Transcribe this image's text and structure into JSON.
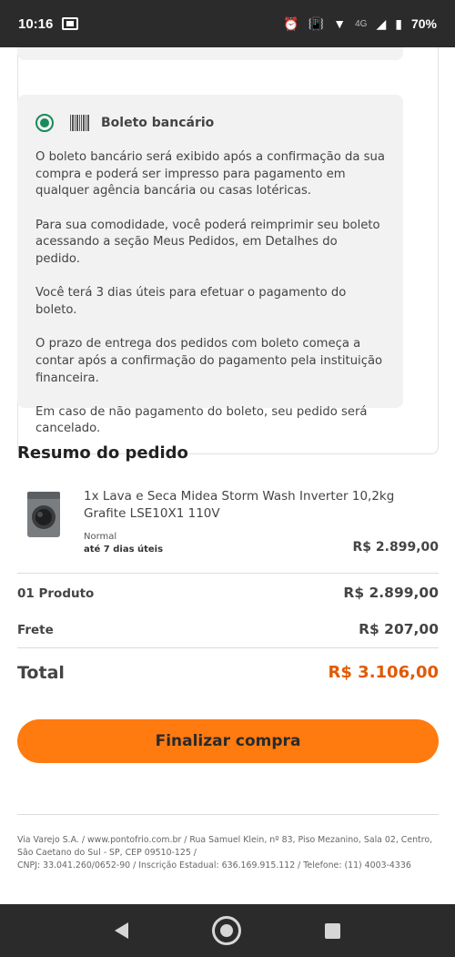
{
  "status_bar": {
    "time": "10:16",
    "network": "4G",
    "battery": "70%",
    "icons": [
      "outlook-icon",
      "alarm-icon",
      "vibrate-icon",
      "wifi-icon",
      "signal-icon",
      "battery-icon"
    ]
  },
  "payment": {
    "method_label": "Boleto bancário",
    "selected": true,
    "paragraphs": [
      "O boleto bancário será exibido após a confirmação da sua compra e poderá ser impresso para pagamento em qualquer agência bancária ou casas lotéricas.",
      "Para sua comodidade, você poderá reimprimir seu boleto acessando a seção Meus Pedidos, em Detalhes do pedido.",
      "Você terá 3 dias úteis para efetuar o pagamento do boleto.",
      "O prazo de entrega dos pedidos com boleto começa a contar após a confirmação do pagamento pela instituição financeira.",
      "Em caso de não pagamento do boleto, seu pedido será cancelado."
    ]
  },
  "summary": {
    "title": "Resumo do pedido",
    "item": {
      "name": "1x Lava e Seca Midea Storm Wash Inverter 10,2kg Grafite LSE10X1 110V",
      "shipping_type": "Normal",
      "shipping_time": "até 7 dias úteis",
      "price": "R$ 2.899,00"
    },
    "products_label": "01 Produto",
    "products_value": "R$ 2.899,00",
    "freight_label": "Frete",
    "freight_value": "R$ 207,00",
    "total_label": "Total",
    "total_value": "R$ 3.106,00"
  },
  "checkout_button": "Finalizar compra",
  "footer": {
    "line1": "Via Varejo S.A. / www.pontofrio.com.br / Rua Samuel Klein, nº 83, Piso Mezanino, Sala 02, Centro, São Caetano do Sul - SP, CEP 09510-125 /",
    "line2": "CNPJ: 33.041.260/0652-90 / Inscrição Estadual: 636.169.915.112 / Telefone: (11) 4003-4336"
  },
  "colors": {
    "accent": "#ff7a0f",
    "total": "#e15a00",
    "radio": "#1b8a5a",
    "system_bar": "#2b2b2b"
  }
}
